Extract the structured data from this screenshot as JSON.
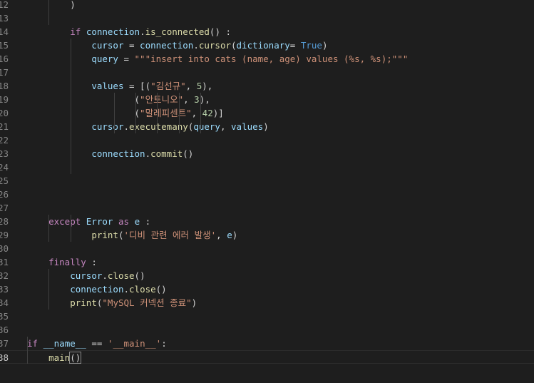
{
  "editor": {
    "lines": [
      {
        "num": "12",
        "tokens": [
          {
            "t": "        )",
            "c": "plain"
          }
        ]
      },
      {
        "num": "13",
        "tokens": []
      },
      {
        "num": "14",
        "tokens": [
          {
            "t": "        ",
            "c": "plain"
          },
          {
            "t": "if",
            "c": "ctrl"
          },
          {
            "t": " ",
            "c": "plain"
          },
          {
            "t": "connection",
            "c": "var"
          },
          {
            "t": ".",
            "c": "plain"
          },
          {
            "t": "is_connected",
            "c": "fn"
          },
          {
            "t": "() :",
            "c": "plain"
          }
        ]
      },
      {
        "num": "15",
        "tokens": [
          {
            "t": "            ",
            "c": "plain"
          },
          {
            "t": "cursor",
            "c": "var"
          },
          {
            "t": " = ",
            "c": "plain"
          },
          {
            "t": "connection",
            "c": "var"
          },
          {
            "t": ".",
            "c": "plain"
          },
          {
            "t": "cursor",
            "c": "fn"
          },
          {
            "t": "(",
            "c": "plain"
          },
          {
            "t": "dictionary",
            "c": "var"
          },
          {
            "t": "= ",
            "c": "plain"
          },
          {
            "t": "True",
            "c": "kw"
          },
          {
            "t": ")",
            "c": "plain"
          }
        ]
      },
      {
        "num": "16",
        "tokens": [
          {
            "t": "            ",
            "c": "plain"
          },
          {
            "t": "query",
            "c": "var"
          },
          {
            "t": " = ",
            "c": "plain"
          },
          {
            "t": "\"\"\"insert into cats (name, age) values (%s, %s);\"\"\"",
            "c": "str"
          }
        ]
      },
      {
        "num": "17",
        "tokens": []
      },
      {
        "num": "18",
        "tokens": [
          {
            "t": "            ",
            "c": "plain"
          },
          {
            "t": "values",
            "c": "var"
          },
          {
            "t": " = [(",
            "c": "plain"
          },
          {
            "t": "\"김선규\"",
            "c": "str"
          },
          {
            "t": ", ",
            "c": "plain"
          },
          {
            "t": "5",
            "c": "num"
          },
          {
            "t": "),",
            "c": "plain"
          }
        ]
      },
      {
        "num": "19",
        "tokens": [
          {
            "t": "                    (",
            "c": "plain"
          },
          {
            "t": "\"안토니오\"",
            "c": "str"
          },
          {
            "t": ", ",
            "c": "plain"
          },
          {
            "t": "3",
            "c": "num"
          },
          {
            "t": "),",
            "c": "plain"
          }
        ]
      },
      {
        "num": "20",
        "tokens": [
          {
            "t": "                    (",
            "c": "plain"
          },
          {
            "t": "\"말레피센트\"",
            "c": "str"
          },
          {
            "t": ", ",
            "c": "plain"
          },
          {
            "t": "42",
            "c": "num"
          },
          {
            "t": ")]",
            "c": "plain"
          }
        ]
      },
      {
        "num": "21",
        "tokens": [
          {
            "t": "            ",
            "c": "plain"
          },
          {
            "t": "cursor",
            "c": "var"
          },
          {
            "t": ".",
            "c": "plain"
          },
          {
            "t": "executemany",
            "c": "fn"
          },
          {
            "t": "(",
            "c": "plain"
          },
          {
            "t": "query",
            "c": "var"
          },
          {
            "t": ", ",
            "c": "plain"
          },
          {
            "t": "values",
            "c": "var"
          },
          {
            "t": ")",
            "c": "plain"
          }
        ]
      },
      {
        "num": "22",
        "tokens": []
      },
      {
        "num": "23",
        "tokens": [
          {
            "t": "            ",
            "c": "plain"
          },
          {
            "t": "connection",
            "c": "var"
          },
          {
            "t": ".",
            "c": "plain"
          },
          {
            "t": "commit",
            "c": "fn"
          },
          {
            "t": "()",
            "c": "plain"
          }
        ]
      },
      {
        "num": "24",
        "tokens": []
      },
      {
        "num": "25",
        "tokens": []
      },
      {
        "num": "26",
        "tokens": []
      },
      {
        "num": "27",
        "tokens": []
      },
      {
        "num": "28",
        "tokens": [
          {
            "t": "    ",
            "c": "plain"
          },
          {
            "t": "except",
            "c": "ctrl"
          },
          {
            "t": " ",
            "c": "plain"
          },
          {
            "t": "Error",
            "c": "var"
          },
          {
            "t": " ",
            "c": "plain"
          },
          {
            "t": "as",
            "c": "ctrl"
          },
          {
            "t": " ",
            "c": "plain"
          },
          {
            "t": "e",
            "c": "var"
          },
          {
            "t": " :",
            "c": "plain"
          }
        ]
      },
      {
        "num": "29",
        "tokens": [
          {
            "t": "            ",
            "c": "plain"
          },
          {
            "t": "print",
            "c": "fn"
          },
          {
            "t": "(",
            "c": "plain"
          },
          {
            "t": "'디비 관련 에러 발생'",
            "c": "str"
          },
          {
            "t": ", ",
            "c": "plain"
          },
          {
            "t": "e",
            "c": "var"
          },
          {
            "t": ")",
            "c": "plain"
          }
        ]
      },
      {
        "num": "30",
        "tokens": []
      },
      {
        "num": "31",
        "tokens": [
          {
            "t": "    ",
            "c": "plain"
          },
          {
            "t": "finally",
            "c": "ctrl"
          },
          {
            "t": " :",
            "c": "plain"
          }
        ]
      },
      {
        "num": "32",
        "tokens": [
          {
            "t": "        ",
            "c": "plain"
          },
          {
            "t": "cursor",
            "c": "var"
          },
          {
            "t": ".",
            "c": "plain"
          },
          {
            "t": "close",
            "c": "fn"
          },
          {
            "t": "()",
            "c": "plain"
          }
        ]
      },
      {
        "num": "33",
        "tokens": [
          {
            "t": "        ",
            "c": "plain"
          },
          {
            "t": "connection",
            "c": "var"
          },
          {
            "t": ".",
            "c": "plain"
          },
          {
            "t": "close",
            "c": "fn"
          },
          {
            "t": "()",
            "c": "plain"
          }
        ]
      },
      {
        "num": "34",
        "tokens": [
          {
            "t": "        ",
            "c": "plain"
          },
          {
            "t": "print",
            "c": "fn"
          },
          {
            "t": "(",
            "c": "plain"
          },
          {
            "t": "\"MySQL 커넥션 종료\"",
            "c": "str"
          },
          {
            "t": ")",
            "c": "plain"
          }
        ]
      },
      {
        "num": "35",
        "tokens": []
      },
      {
        "num": "36",
        "tokens": []
      },
      {
        "num": "37",
        "tokens": [
          {
            "t": "if",
            "c": "ctrl"
          },
          {
            "t": " ",
            "c": "plain"
          },
          {
            "t": "__name__",
            "c": "var"
          },
          {
            "t": " == ",
            "c": "plain"
          },
          {
            "t": "'__main__'",
            "c": "str"
          },
          {
            "t": ":",
            "c": "plain"
          }
        ]
      },
      {
        "num": "38",
        "tokens": [
          {
            "t": "    ",
            "c": "plain"
          },
          {
            "t": "main",
            "c": "fn"
          },
          {
            "t": "()",
            "c": "bracket"
          }
        ]
      }
    ],
    "current_line": "38"
  }
}
